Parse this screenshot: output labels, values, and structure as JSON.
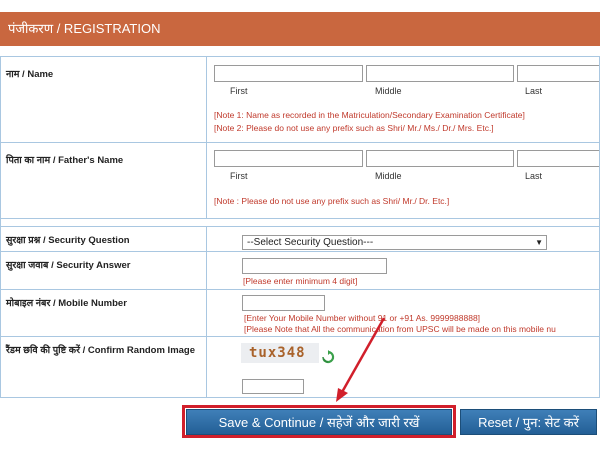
{
  "header": {
    "title": "पंजीकरण / REGISTRATION"
  },
  "name_row": {
    "label": "नाम / Name",
    "sub_first": "First",
    "sub_middle": "Middle",
    "sub_last": "Last",
    "note1": "[Note 1: Name as recorded in the Matriculation/Secondary Examination Certificate]",
    "note2": "[Note 2: Please do not use any prefix such as Shri/ Mr./ Ms./ Dr./ Mrs. Etc.]"
  },
  "father_row": {
    "label": "पिता का नाम / Father's Name",
    "sub_first": "First",
    "sub_middle": "Middle",
    "sub_last": "Last",
    "note": "[Note : Please do not use any prefix such as Shri/ Mr./ Dr. Etc.]"
  },
  "security_question": {
    "label": "सुरक्षा प्रश्न / Security Question",
    "selected": "--Select Security Question---"
  },
  "security_answer": {
    "label": "सुरक्षा जवाब / Security Answer",
    "note": "[Please enter minimum 4 digit]"
  },
  "mobile": {
    "label": "मोबाइल नंबर / Mobile Number",
    "note1": "[Enter Your Mobile Number without 91 or +91 As. 9999988888]",
    "note2": "[Please Note that All the communication from UPSC will be made on this mobile nu"
  },
  "captcha": {
    "label": "रैंडम छवि की पुष्टि करें / Confirm Random Image",
    "text": "tux348",
    "refresh_icon": "refresh-icon"
  },
  "buttons": {
    "save": "Save & Continue / सहेजें और जारी रखें",
    "reset": "Reset / पुन: सेट करें"
  },
  "colors": {
    "header": "#c9673f",
    "note": "#c0392b",
    "button": "#2f6ea7",
    "highlight": "#d11f2b"
  }
}
